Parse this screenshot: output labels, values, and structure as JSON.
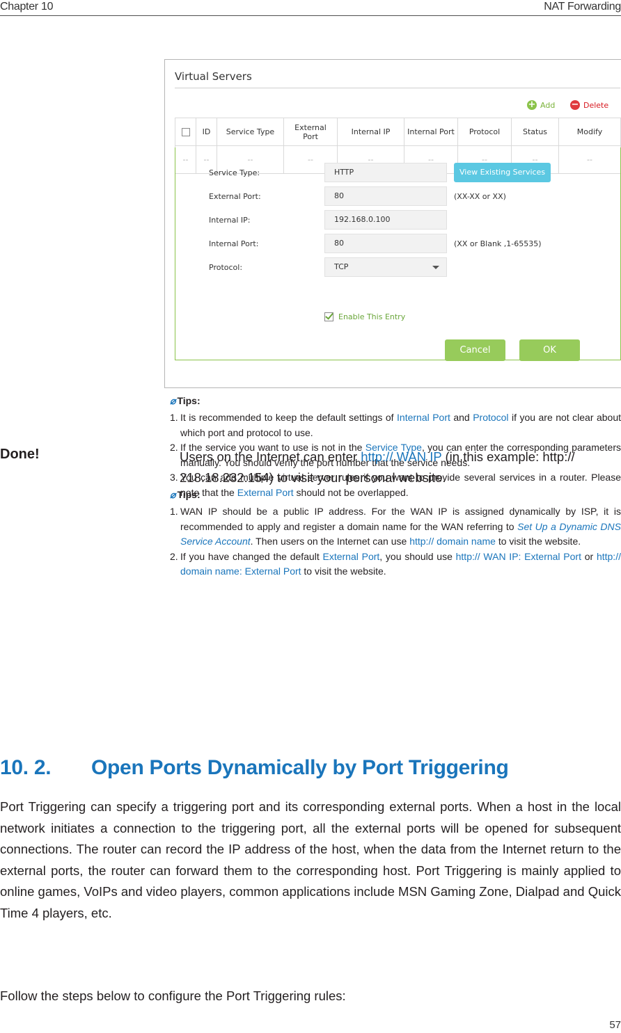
{
  "header": {
    "chapter": "Chapter 10",
    "section": "NAT Forwarding"
  },
  "screenshot": {
    "title": "Virtual Servers",
    "toolbar": {
      "add": "Add",
      "delete": "Delete",
      "add_icon": "plus-circle-icon",
      "delete_icon": "minus-circle-icon"
    },
    "table": {
      "columns": [
        "ID",
        "Service Type",
        "External Port",
        "Internal IP",
        "Internal Port",
        "Protocol",
        "Status",
        "Modify"
      ],
      "empty_row": [
        "--",
        "--",
        "--",
        "--",
        "--",
        "--",
        "--",
        "--",
        "--"
      ]
    },
    "form": {
      "service_type_label": "Service Type:",
      "service_type_value": "HTTP",
      "view_existing_label": "View Existing Services",
      "external_port_label": "External Port:",
      "external_port_value": "80",
      "external_port_hint": "(XX-XX or XX)",
      "internal_ip_label": "Internal IP:",
      "internal_ip_value": "192.168.0.100",
      "internal_port_label": "Internal Port:",
      "internal_port_value": "80",
      "internal_port_hint": "(XX or Blank ,1-65535)",
      "protocol_label": "Protocol:",
      "protocol_value": "TCP",
      "enable_label": "Enable This Entry",
      "enable_checked": true,
      "cancel_label": "Cancel",
      "ok_label": "OK"
    }
  },
  "tips1": {
    "heading": "Tips:",
    "items": [
      {
        "num": "1.",
        "a": "It is recommended to keep the default settings of ",
        "b": "Internal Port",
        "c": " and ",
        "d": "Protocol",
        "e": " if you are not clear about which port and protocol to use."
      },
      {
        "num": "2.",
        "a": "If the service you want to use is not in the ",
        "b": "Service Type",
        "c": ", you can enter the corresponding parameters manually. You should verify the port number that the service needs."
      },
      {
        "num": "3.",
        "a": "You can add multiple virtual server rules if you want to provide several services in a router. Please note that the ",
        "b": "External Port",
        "c": " should not be overlapped."
      }
    ]
  },
  "done": {
    "label": "Done!",
    "text_a": "Users on the Internet can enter ",
    "text_link": "http:// WAN IP",
    "text_b": " (in this example: http:// 218.18.232.154) to visit your personal website."
  },
  "tips2": {
    "heading": "Tips:",
    "items": [
      {
        "num": "1.",
        "a": "WAN IP should be a public IP address. For the WAN IP is assigned dynamically by ISP, it is recommended to apply and register a domain name for the WAN referring to ",
        "b": "Set Up a Dynamic DNS Service Account",
        "c": ". Then users on the Internet can use ",
        "d": "http:// domain name",
        "e": " to visit the website."
      },
      {
        "num": "2.",
        "a": "If you have changed the default ",
        "b": "External Port",
        "c": ", you should use ",
        "d": "http:// WAN IP: External Port",
        "e": " or ",
        "f": "http:// domain name: External Port",
        "g": " to visit the website."
      }
    ]
  },
  "section": {
    "number": "10. 2.",
    "title": "Open Ports Dynamically by Port Triggering",
    "paragraph": "Port Triggering can specify a triggering port and its corresponding external ports. When a host in the local network initiates a connection to the triggering port, all the external ports will be opened for subsequent connections. The router can record the IP address of the host, when the data from the Internet return to the external ports, the router can forward them to the corresponding host. Port Triggering is mainly applied to online games, VoIPs and video players, common applications include MSN Gaming Zone, Dialpad and Quick Time 4 players, etc.",
    "follow": "Follow the steps below to configure the Port Triggering rules:"
  },
  "page_number": "57",
  "colors": {
    "accent_blue": "#1a75bb",
    "green": "#8bc34a",
    "red": "#e03a3e",
    "cyan": "#5bc8e2"
  }
}
